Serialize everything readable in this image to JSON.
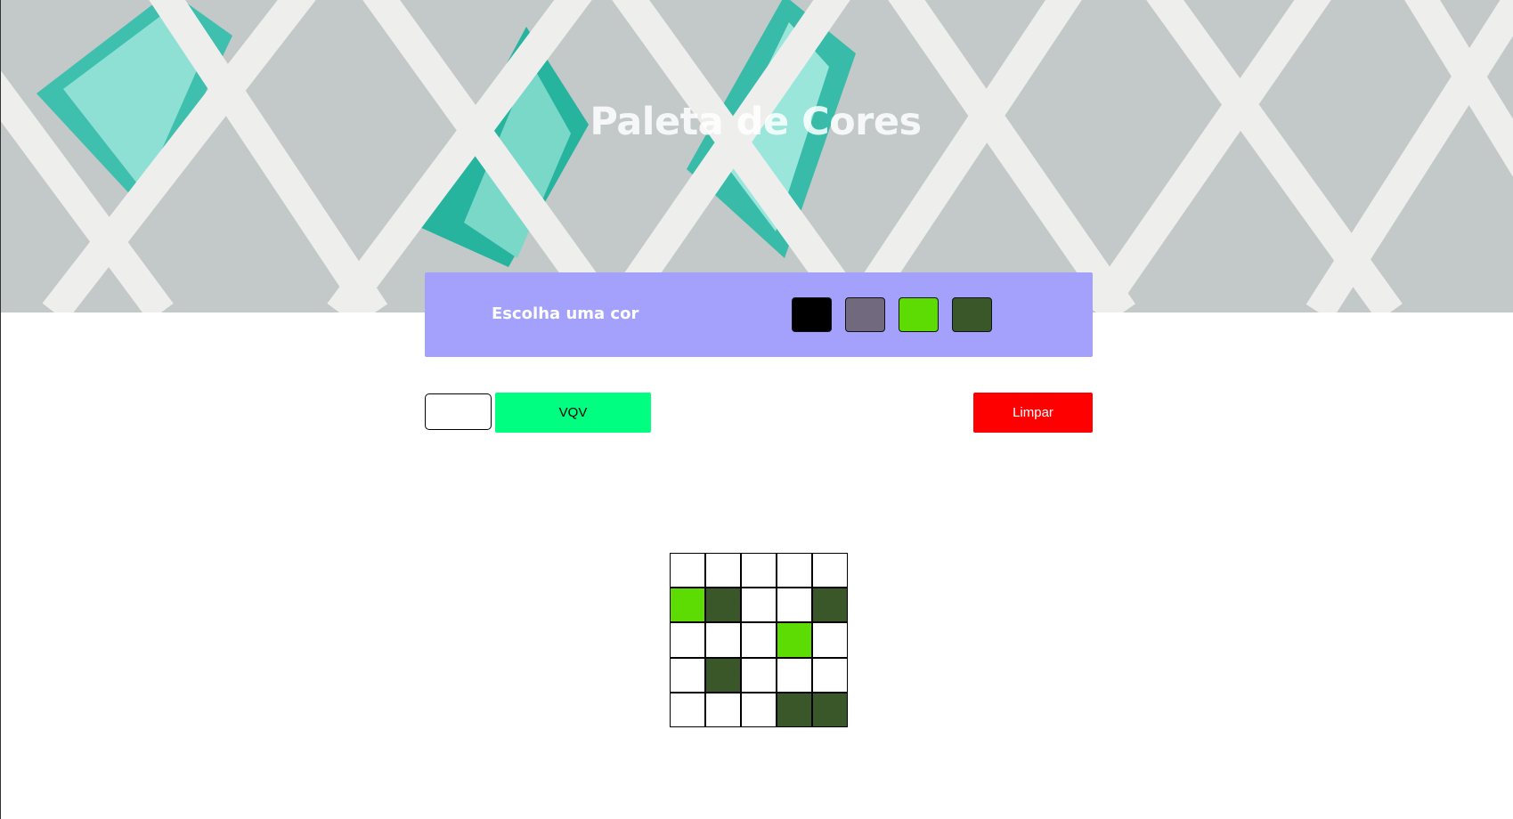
{
  "page": {
    "title": "Paleta de Cores"
  },
  "palette": {
    "label": "Escolha uma cor",
    "colors": [
      "#000000",
      "#716a7f",
      "#5ddc04",
      "#3a5729"
    ]
  },
  "controls": {
    "size_input_value": "",
    "generate_label": "VQV",
    "clear_label": "Limpar"
  },
  "board": {
    "columns": 5,
    "rows": 5,
    "pixels": [
      "#ffffff",
      "#ffffff",
      "#ffffff",
      "#ffffff",
      "#ffffff",
      "#5ddc04",
      "#3a5729",
      "#ffffff",
      "#ffffff",
      "#3a5729",
      "#ffffff",
      "#ffffff",
      "#ffffff",
      "#5ddc04",
      "#ffffff",
      "#ffffff",
      "#3a5729",
      "#ffffff",
      "#ffffff",
      "#ffffff",
      "#ffffff",
      "#ffffff",
      "#ffffff",
      "#3a5729",
      "#3a5729"
    ]
  },
  "colors": {
    "panel": "#a3a1fc",
    "generate_button": "#00ff80",
    "clear_button": "#ff0000"
  }
}
